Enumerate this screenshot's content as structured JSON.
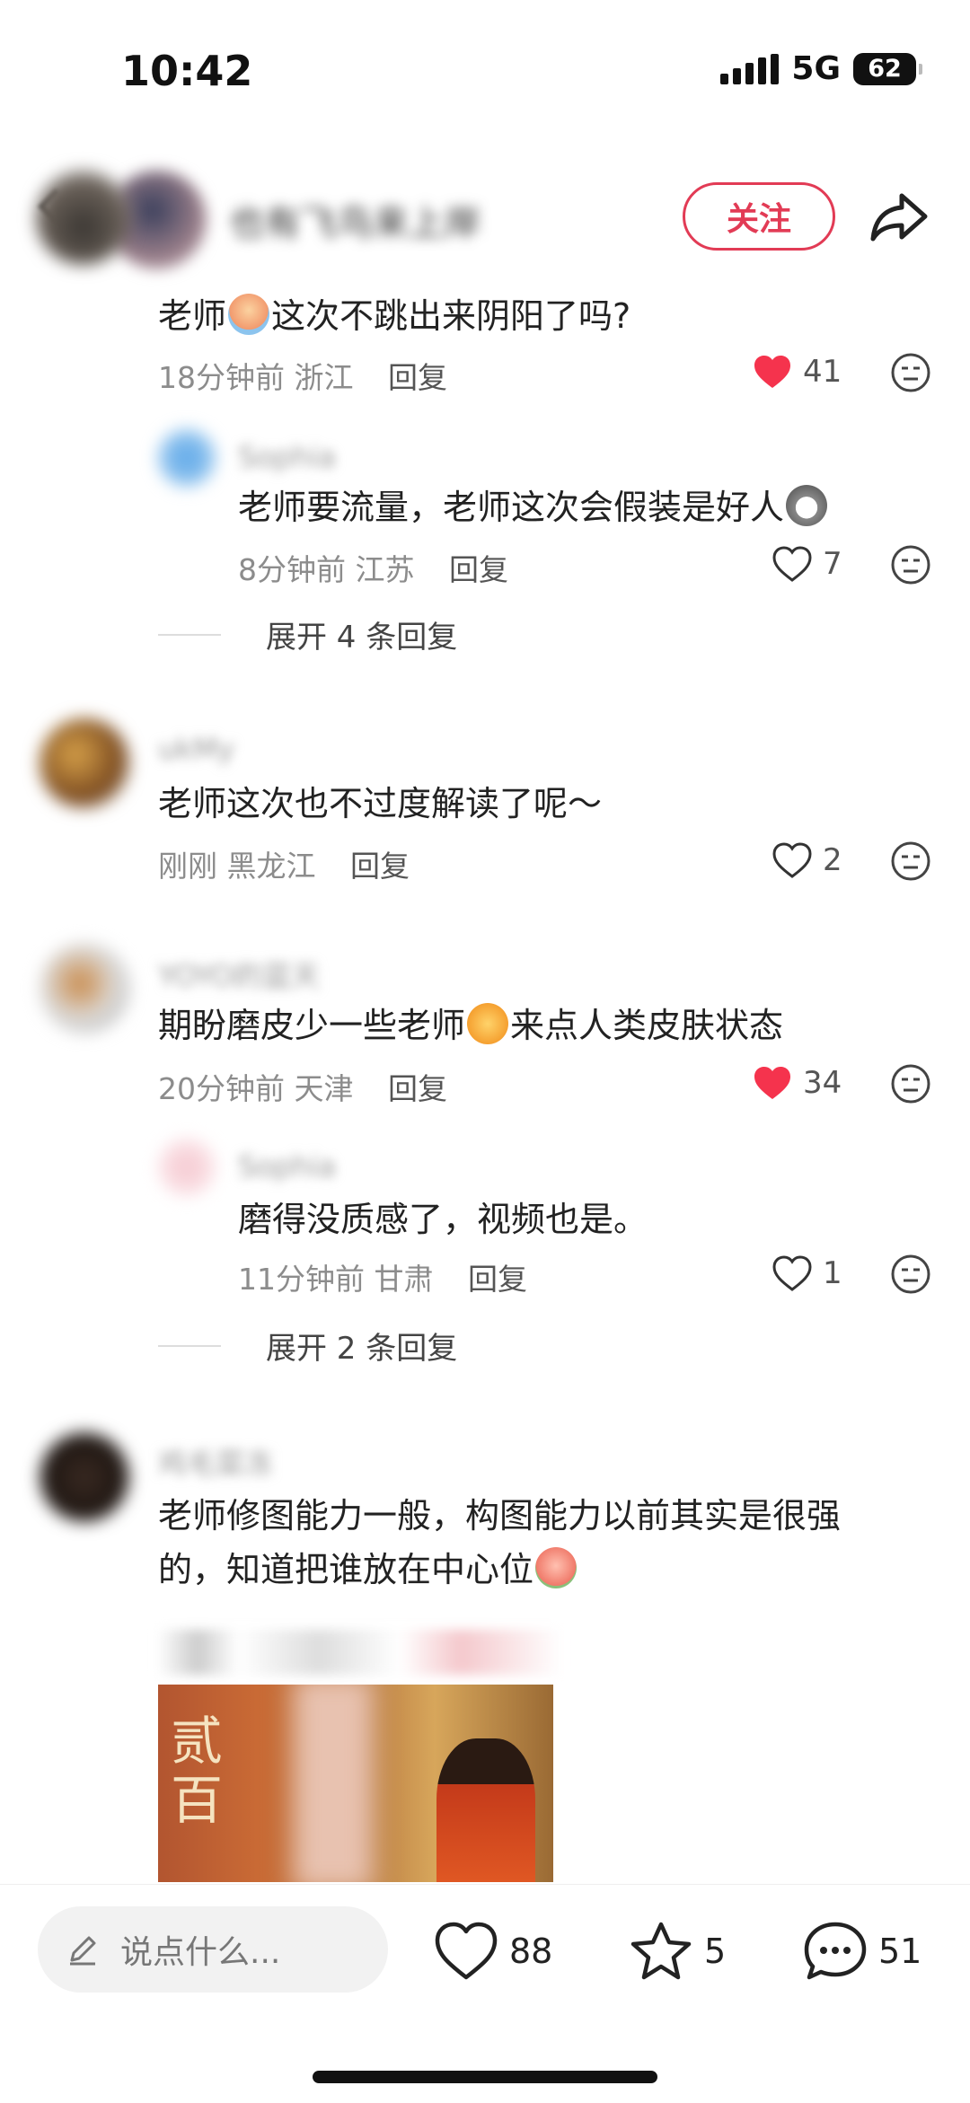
{
  "status_bar": {
    "time": "10:42",
    "network": "5G",
    "battery": "62"
  },
  "header": {
    "author_name": "也有飞鸟来上岸",
    "follow_label": "关注"
  },
  "comments": [
    {
      "nickname": "",
      "text_before": "老师",
      "text_after": "这次不跳出来阴阳了吗?",
      "time": "18分钟前",
      "location": "浙江",
      "reply_label": "回复",
      "likes": "41",
      "liked": true,
      "replies": [
        {
          "nickname": "Sophia",
          "text": "老师要流量，老师这次会假装是好人",
          "time": "8分钟前",
          "location": "江苏",
          "reply_label": "回复",
          "likes": "7",
          "liked": false
        }
      ],
      "expand_label": "展开 4 条回复"
    },
    {
      "nickname": "ukMy",
      "text": "老师这次也不过度解读了呢～",
      "time": "刚刚",
      "location": "黑龙江",
      "reply_label": "回复",
      "likes": "2",
      "liked": false
    },
    {
      "nickname": "YOYO的蓝天",
      "text_before": "期盼磨皮少一些老师",
      "text_after": "来点人类皮肤状态",
      "time": "20分钟前",
      "location": "天津",
      "reply_label": "回复",
      "likes": "34",
      "liked": true,
      "replies": [
        {
          "nickname": "Sophia",
          "text": "磨得没质感了，视频也是。",
          "time": "11分钟前",
          "location": "甘肃",
          "reply_label": "回复",
          "likes": "1",
          "liked": false
        }
      ],
      "expand_label": "展开 2 条回复"
    },
    {
      "nickname": "鸡毛菜冻",
      "text_line1": "老师修图能力一般，构图能力以前其实是很强",
      "text_line2": "的，知道把谁放在中心位",
      "attachment": {
        "poster_text": "贰百"
      }
    }
  ],
  "bottom_bar": {
    "input_placeholder": "说点什么...",
    "likes": "88",
    "favorites": "5",
    "comments": "51"
  },
  "colors": {
    "accent": "#e23b55",
    "liked": "#f5334d",
    "text": "#222222",
    "meta": "#8c8c8c"
  },
  "icons": [
    "back-icon",
    "share-icon",
    "heart-icon",
    "dislike-icon",
    "pencil-icon",
    "star-icon",
    "comment-bubble-icon"
  ]
}
